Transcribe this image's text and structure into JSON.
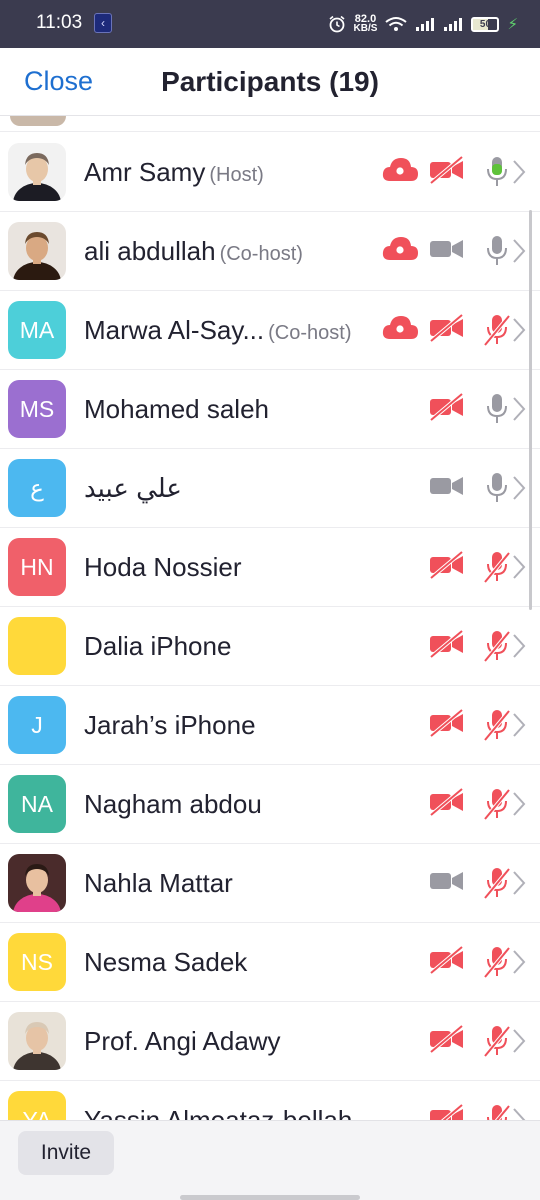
{
  "status_bar": {
    "time": "11:03",
    "notification_icon": "app-notification-icon",
    "speed_value": "82.0",
    "speed_unit": "KB/S",
    "battery": "50",
    "icons": [
      "alarm-icon",
      "wifi-icon",
      "signal-icon",
      "signal-icon",
      "battery-icon",
      "charging-icon"
    ]
  },
  "header": {
    "close_label": "Close",
    "title": "Participants (19)"
  },
  "colors": {
    "accent": "#1e6fd0",
    "alert_red": "#f0505a",
    "muted_grey": "#9a9aa2",
    "active_green": "#5ec23a"
  },
  "participants": [
    {
      "name": "Amr Samy",
      "role": "(Host)",
      "avatar": "photo",
      "cloud": true,
      "video": "off",
      "mic": "active"
    },
    {
      "name": "ali abdullah",
      "role": "(Co-host)",
      "avatar": "photo",
      "cloud": true,
      "video": "on",
      "mic": "on"
    },
    {
      "name": "Marwa Al-Say...",
      "role": "(Co-host)",
      "initials": "MA",
      "avatar_color": "#4dcfd9",
      "cloud": true,
      "video": "off",
      "mic": "muted"
    },
    {
      "name": "Mohamed saleh",
      "role": "",
      "initials": "MS",
      "avatar_color": "#9b6fd0",
      "cloud": false,
      "video": "off",
      "mic": "on"
    },
    {
      "name": "علي عبيد",
      "role": "",
      "initials": "ع",
      "avatar_color": "#4cb8f0",
      "cloud": false,
      "video": "on",
      "mic": "on"
    },
    {
      "name": "Hoda Nossier",
      "role": "",
      "initials": "HN",
      "avatar_color": "#f0606a",
      "cloud": false,
      "video": "off",
      "mic": "muted"
    },
    {
      "name": "Dalia iPhone",
      "role": "",
      "initials": "",
      "avatar_color": "#ffd93a",
      "cloud": false,
      "video": "off",
      "mic": "muted"
    },
    {
      "name": "Jarah’s iPhone",
      "role": "",
      "initials": "J",
      "avatar_color": "#4cb8f0",
      "cloud": false,
      "video": "off",
      "mic": "muted"
    },
    {
      "name": "Nagham abdou",
      "role": "",
      "initials": "NA",
      "avatar_color": "#3fb59c",
      "cloud": false,
      "video": "off",
      "mic": "muted"
    },
    {
      "name": "Nahla Mattar",
      "role": "",
      "avatar": "photo",
      "cloud": false,
      "video": "on",
      "mic": "muted"
    },
    {
      "name": "Nesma Sadek",
      "role": "",
      "initials": "NS",
      "avatar_color": "#ffd93a",
      "cloud": false,
      "video": "off",
      "mic": "muted"
    },
    {
      "name": "Prof. Angi Adawy",
      "role": "",
      "avatar": "photo",
      "cloud": false,
      "video": "off",
      "mic": "muted"
    },
    {
      "name": "Yassin Almoataz-bellah",
      "role": "",
      "initials": "YA",
      "avatar_color": "#ffd93a",
      "cloud": false,
      "video": "off",
      "mic": "muted"
    }
  ],
  "footer": {
    "invite_label": "Invite"
  }
}
